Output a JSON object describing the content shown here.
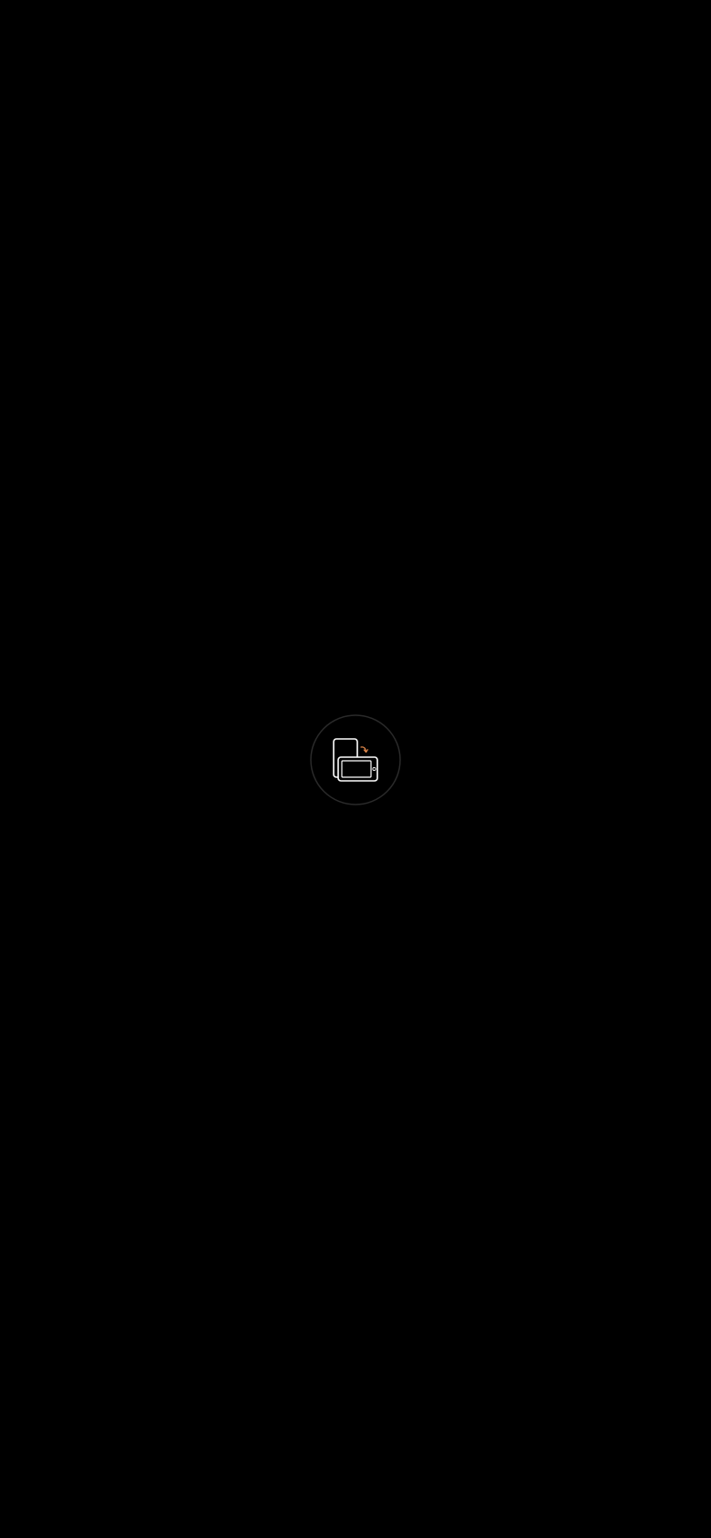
{
  "screen": {
    "background_color": "#000000"
  },
  "rotate_prompt": {
    "icon": "rotate-device-icon",
    "ring_color": "#2a2a2a",
    "device_color": "#ffffff",
    "arrow_color": "#e0874a"
  }
}
